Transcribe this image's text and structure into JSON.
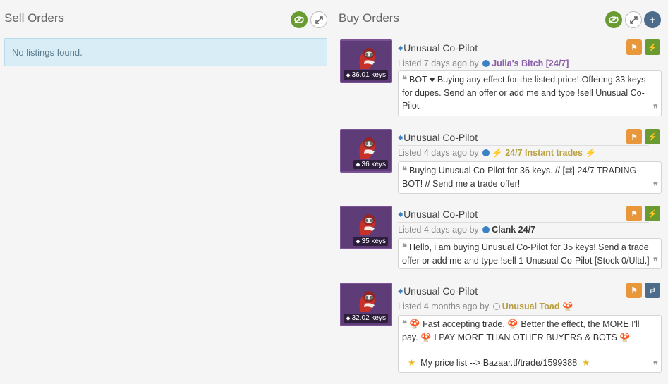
{
  "sell": {
    "title": "Sell Orders",
    "empty": "No listings found.",
    "icons": [
      "eye-icon",
      "expand-icon"
    ]
  },
  "buy": {
    "title": "Buy Orders",
    "icons": [
      "eye-icon",
      "expand-icon",
      "plus-icon"
    ],
    "plus": "+"
  },
  "listings": [
    {
      "name": "Unusual Co-Pilot",
      "price": "36.01 keys",
      "listed": "Listed 7 days ago by",
      "user": "Julia's Bitch [24/7]",
      "msg_before": "BOT ♥ Buying any effect for the listed price! Offering 33 keys for dupes. Send an offer or add me and type !sell Unusual Co-Pilot",
      "action2": "bolt-icon"
    },
    {
      "name": "Unusual Co-Pilot",
      "price": "36 keys",
      "listed": "Listed 4 days ago by",
      "user": "24/7 Instant trades",
      "msg_before": "Buying Unusual Co-Pilot for 36 keys. // [",
      "msg_swap": "⇄",
      "msg_after": "] 24/7 TRADING BOT! // Send me a trade offer!",
      "action2": "bolt-icon"
    },
    {
      "name": "Unusual Co-Pilot",
      "price": "35 keys",
      "listed": "Listed 4 days ago by",
      "user": "Clank 24/7",
      "msg_before": "Hello, i am buying Unusual Co-Pilot for 35 keys! Send a trade offer or add me and type !sell 1 Unusual Co-Pilot [Stock 0/Ultd.]",
      "action2": "bolt-icon"
    },
    {
      "name": "Unusual Co-Pilot",
      "price": "32.02 keys",
      "listed": "Listed 4 months ago by",
      "user": "Unusual Toad",
      "msg_line1": "Fast accepting trade.",
      "msg_line1b": "Better the effect, the MORE I'll pay.",
      "msg_line1c": "I PAY MORE THAN OTHER BUYERS & BOTS",
      "msg_line2": "My price list --> Bazaar.tf/trade/1599388",
      "action2": "swap-icon"
    }
  ]
}
